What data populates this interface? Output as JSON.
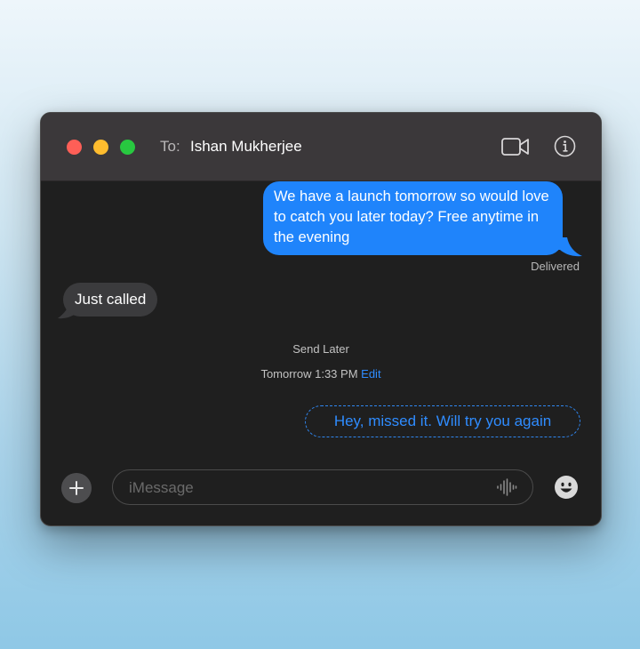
{
  "titlebar": {
    "to_label": "To:",
    "recipient": "Ishan Mukherjee",
    "icons": {
      "video": "video-camera-icon",
      "info": "info-icon"
    }
  },
  "messages": [
    {
      "direction": "outgoing",
      "text": "We have a launch tomorrow so would love to catch you later today? Free anytime in the evening",
      "status": "Delivered"
    },
    {
      "direction": "incoming",
      "text": "Just called"
    }
  ],
  "scheduled": {
    "heading": "Send Later",
    "time": "Tomorrow 1:33 PM",
    "edit_label": "Edit",
    "message": "Hey, missed it. Will try you again"
  },
  "composer": {
    "placeholder": "iMessage",
    "icons": {
      "add": "plus-icon",
      "audio": "audio-waveform-icon",
      "emoji": "emoji-icon"
    }
  },
  "colors": {
    "outgoing_bubble": "#1f84fb",
    "incoming_bubble": "#3b3b3d",
    "accent": "#2f8cff",
    "titlebar": "#3b383a",
    "window_bg": "#1f1f1f"
  }
}
